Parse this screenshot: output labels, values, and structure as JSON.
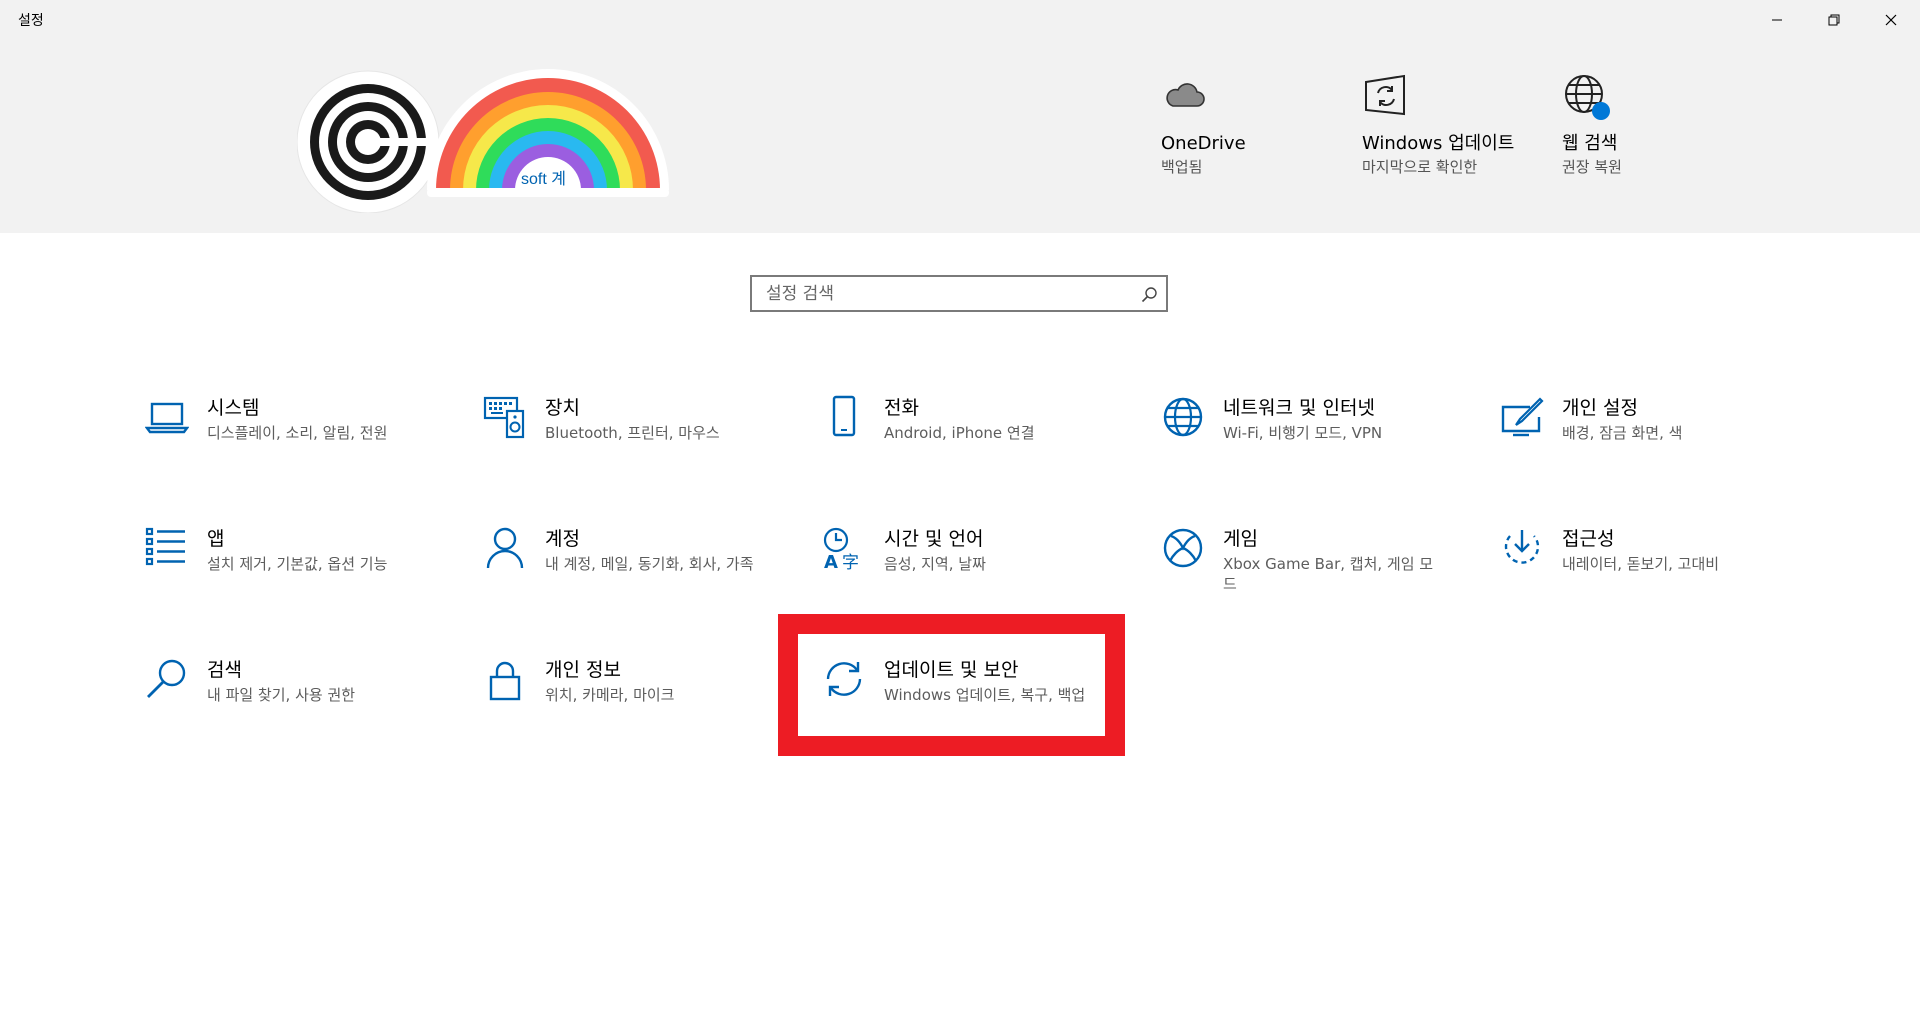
{
  "window": {
    "title": "설정"
  },
  "avatar": {
    "overlay_text": "soft 계"
  },
  "quick": [
    {
      "title": "OneDrive",
      "sub": "백업됨",
      "icon": "cloud-icon"
    },
    {
      "title": "Windows 업데이트",
      "sub": "마지막으로 확인한",
      "icon": "windows-update-icon"
    },
    {
      "title": "웹 검색",
      "sub": "권장 복원",
      "icon": "globe-icon"
    }
  ],
  "search": {
    "placeholder": "설정 검색"
  },
  "categories": [
    {
      "title": "시스템",
      "sub": "디스플레이, 소리, 알림, 전원",
      "icon": "laptop-icon"
    },
    {
      "title": "장치",
      "sub": "Bluetooth, 프린터, 마우스",
      "icon": "devices-icon"
    },
    {
      "title": "전화",
      "sub": "Android, iPhone 연결",
      "icon": "phone-icon"
    },
    {
      "title": "네트워크 및 인터넷",
      "sub": "Wi-Fi, 비행기 모드, VPN",
      "icon": "network-globe-icon"
    },
    {
      "title": "개인 설정",
      "sub": "배경, 잠금 화면, 색",
      "icon": "personalization-icon"
    },
    {
      "title": "앱",
      "sub": "설치 제거, 기본값, 옵션 기능",
      "icon": "apps-list-icon"
    },
    {
      "title": "계정",
      "sub": "내 계정, 메일, 동기화, 회사, 가족",
      "icon": "person-icon"
    },
    {
      "title": "시간 및 언어",
      "sub": "음성, 지역, 날짜",
      "icon": "time-language-icon"
    },
    {
      "title": "게임",
      "sub": "Xbox Game Bar, 캡처, 게임 모드",
      "icon": "xbox-icon"
    },
    {
      "title": "접근성",
      "sub": "내레이터, 돋보기, 고대비",
      "icon": "accessibility-icon"
    },
    {
      "title": "검색",
      "sub": "내 파일 찾기, 사용 권한",
      "icon": "magnifier-icon"
    },
    {
      "title": "개인 정보",
      "sub": "위치, 카메라, 마이크",
      "icon": "lock-icon"
    },
    {
      "title": "업데이트 및 보안",
      "sub": "Windows 업데이트, 복구, 백업",
      "icon": "sync-icon"
    }
  ],
  "colors": {
    "accent": "#0063b1",
    "highlight": "#ed1c24",
    "header_bg": "#f2f2f2"
  }
}
